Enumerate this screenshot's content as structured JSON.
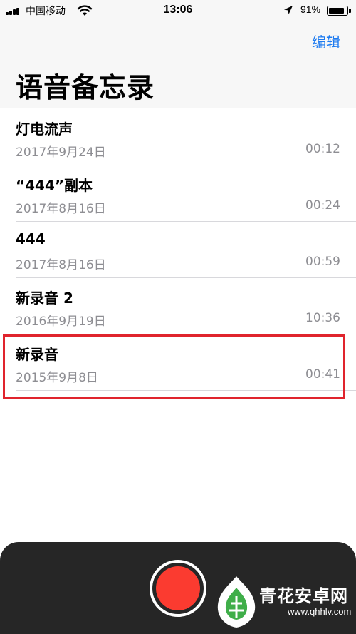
{
  "status_bar": {
    "carrier": "中国移动",
    "time": "13:06",
    "battery_text": "91%",
    "battery_level": 0.91
  },
  "nav": {
    "edit_label": "编辑",
    "title": "语音备忘录"
  },
  "memos": [
    {
      "title": "灯电流声",
      "date": "2017年9月24日",
      "duration": "00:12"
    },
    {
      "title": "“444”副本",
      "date": "2017年8月16日",
      "duration": "00:24"
    },
    {
      "title": "444",
      "date": "2017年8月16日",
      "duration": "00:59"
    },
    {
      "title": "新录音 2",
      "date": "2016年9月19日",
      "duration": "10:36"
    },
    {
      "title": "新录音",
      "date": "2015年9月8日",
      "duration": "00:41"
    }
  ],
  "watermark": {
    "name": "青花安卓网",
    "url": "www.qhhlv.com"
  },
  "colors": {
    "accent": "#1e7bf0",
    "record": "#fb3b30",
    "highlight": "#e0242d",
    "panel": "#262626"
  },
  "icons": [
    "signal-icon",
    "wifi-icon",
    "location-icon",
    "battery-icon",
    "record-icon"
  ]
}
